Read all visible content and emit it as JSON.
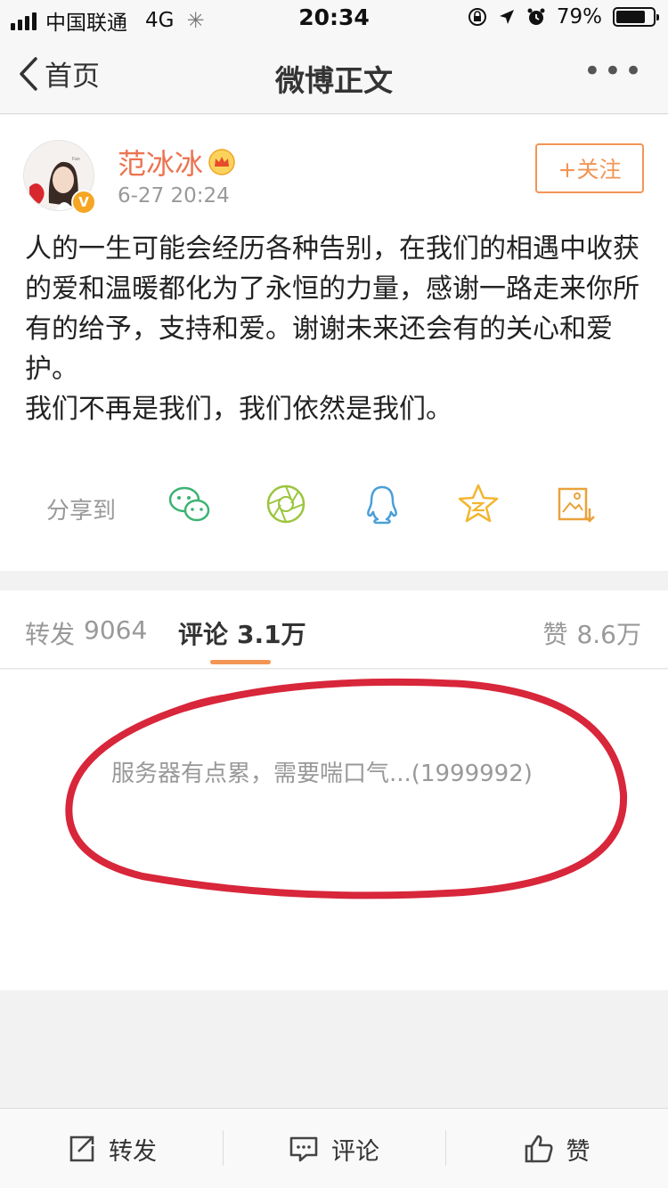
{
  "status_bar": {
    "carrier": "中国联通",
    "network": "4G",
    "time": "20:34",
    "battery": "79%",
    "battery_level": 0.79
  },
  "nav": {
    "back_label": "首页",
    "title": "微博正文",
    "more_label": "•••"
  },
  "post": {
    "author": "范冰冰",
    "time": "6-27 20:24",
    "follow_label": "+关注",
    "verified_mark": "V",
    "text_lines": [
      "人的一生可能会经历各种告别，在我们的相遇中收获的爱和温暖都化为了永恒的力量，感谢一路走来你所有的给予，支持和爱。谢谢未来还会有的关心和爱护。",
      "我们不再是我们，我们依然是我们。"
    ]
  },
  "share": {
    "label": "分享到",
    "icons": [
      "wechat-icon",
      "moments-icon",
      "qq-icon",
      "qzone-icon",
      "save-image-icon"
    ]
  },
  "tabs": {
    "repost_label": "转发",
    "repost_count": "9064",
    "comment_label": "评论",
    "comment_count": "3.1万",
    "like_label": "赞",
    "like_count": "8.6万"
  },
  "comments": {
    "message": "服务器有点累，需要喘口气...(1999992)"
  },
  "bottom_bar": {
    "repost": "转发",
    "comment": "评论",
    "like": "赞"
  },
  "colors": {
    "accent": "#f29555",
    "author_name": "#eb7350",
    "annotation_red": "#d8263a"
  }
}
